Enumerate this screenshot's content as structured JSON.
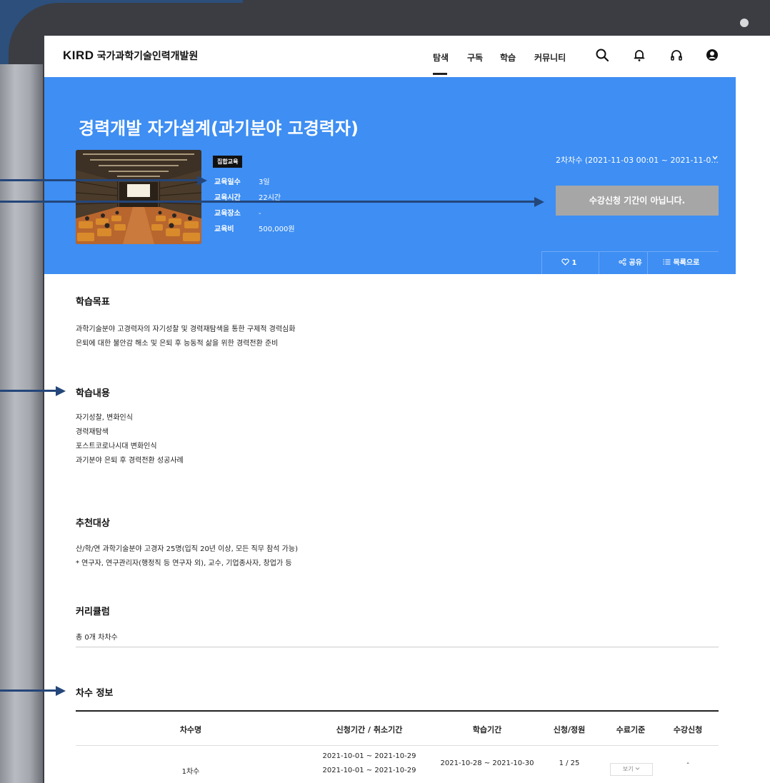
{
  "header": {
    "logo": "KIRD",
    "logo_sub": "국가과학기술인력개발원",
    "nav": [
      "탐색",
      "구독",
      "학습",
      "커뮤니티"
    ]
  },
  "banner": {
    "title": "경력개발 자가설계(과기분야 고경력자)",
    "badge": "집합교육",
    "info": [
      {
        "label": "교육일수",
        "value": "3일"
      },
      {
        "label": "교육시간",
        "value": "22시간"
      },
      {
        "label": "교육장소",
        "value": "-"
      },
      {
        "label": "교육비",
        "value": "500,000원"
      }
    ],
    "session_select": "2차차수 (2021-11-03 00:01 ~ 2021-11-0...",
    "apply_button": "수강신청 기간이 아닙니다.",
    "like_count": "1",
    "share_label": "공유",
    "list_label": "목록으로"
  },
  "sections": {
    "goal_title": "학습목표",
    "goal_lines": [
      "과학기술분야 고경력자의 자기성찰 및 경력재탐색을 통한 구제적 경력심화",
      "은퇴에 대한 불안감 해소 및 은퇴 후 능동적 삶을 위한 경력전환 준비"
    ],
    "content_title": "학습내용",
    "content_lines": [
      "자기성찰, 변화인식",
      "경력재탐색",
      "포스트코로나시대 변화인식",
      "과기분야 은퇴 후 경력전환 성공사례"
    ],
    "target_title": "추천대상",
    "target_lines": [
      "산/학/연 과학기술분야 고경자 25명(입직 20년 이상, 모든 직무 참석 가능)",
      "* 연구자, 연구관리자(행정직 등 연구자 외), 교수, 기업종사자, 창업가 등"
    ],
    "curriculum_title": "커리큘럼",
    "curriculum_count": "총 0개 차차수",
    "session_title": "차수 정보"
  },
  "table": {
    "headers": [
      "차수명",
      "신청기간 / 취소기간",
      "학습기간",
      "신청/정원",
      "수료기준",
      "수강신청"
    ],
    "rows": [
      {
        "name": "1차수",
        "apply_period": "2021-10-01 ~ 2021-10-29",
        "cancel_period": "2021-10-01 ~ 2021-10-29",
        "study_period": "2021-10-28 ~ 2021-10-30",
        "capacity": "1 / 25",
        "criteria": "보기",
        "enroll": "-"
      }
    ]
  },
  "colors": {
    "banner": "#3e8ef3",
    "apply_button": "#a6a6a6",
    "arrow": "#24467a",
    "frame": "#3b3d42"
  }
}
